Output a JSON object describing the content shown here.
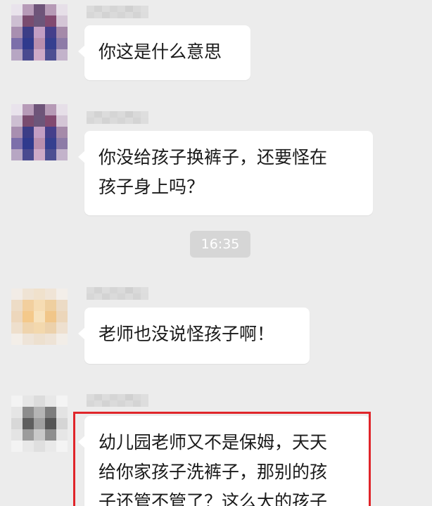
{
  "messages": [
    {
      "sender": "contact_a",
      "text": "你这是什么意思"
    },
    {
      "sender": "contact_a",
      "text": "你没给孩子换裤子，还要怪在\n孩子身上吗？"
    },
    {
      "sender": "contact_b",
      "text": "老师也没说怪孩子啊！"
    },
    {
      "sender": "contact_c",
      "text": "幼儿园老师又不是保姆，天天\n给你家孩子洗裤子，那别的孩\n子还管不管了？这么大的孩子"
    }
  ],
  "timestamp": "16:35",
  "colors": {
    "background": "#ececec",
    "bubble": "#ffffff",
    "highlight": "#e0252a",
    "timestamp_pill": "#d6d6d6"
  },
  "icons": [
    "avatar-purple-mosaic",
    "avatar-beige-mosaic",
    "avatar-gray-mosaic"
  ]
}
